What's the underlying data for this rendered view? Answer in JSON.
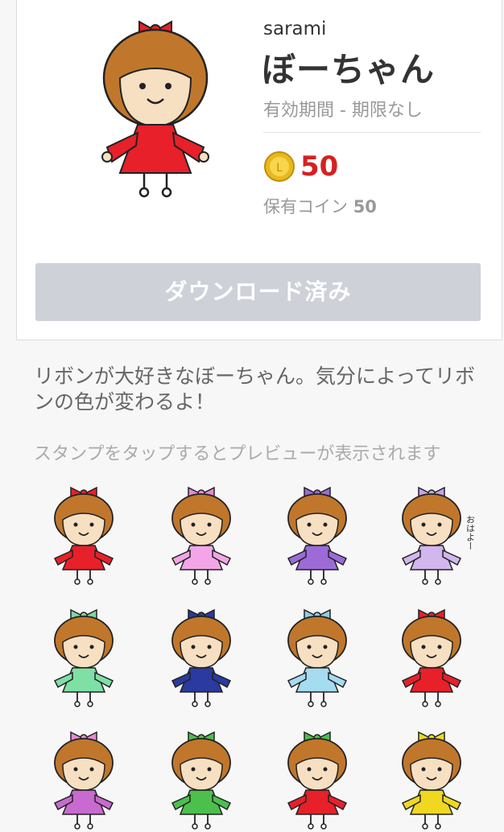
{
  "product": {
    "author": "sarami",
    "title": "ぼーちゃん",
    "validity": "有効期間 - 期限なし",
    "price": "50",
    "owned_label": "保有コイン",
    "owned_value": "50",
    "download_label": "ダウンロード済み",
    "coin_icon": "coin-icon"
  },
  "description": "リボンが大好きなぼーちゃん。気分によってリボンの色が変わるよ！",
  "preview_hint": "スタンプをタップするとプレビューが表示されます",
  "stickers": [
    {
      "ribbon": "#e8202a",
      "dress": "#e8202a",
      "text": ""
    },
    {
      "ribbon": "#e48ad6",
      "dress": "#f2a6e8",
      "text": ""
    },
    {
      "ribbon": "#9c6bd8",
      "dress": "#9c6bd8",
      "text": ""
    },
    {
      "ribbon": "#c8a2e8",
      "dress": "#d2b6ee",
      "text": "おはよー"
    },
    {
      "ribbon": "#7fd6a0",
      "dress": "#7fe0a6",
      "text": ""
    },
    {
      "ribbon": "#2a3aa0",
      "dress": "#2a3aa0",
      "text": ""
    },
    {
      "ribbon": "#8ccfe8",
      "dress": "#a6dcf0",
      "text": ""
    },
    {
      "ribbon": "#e8202a",
      "dress": "#e8202a",
      "text": ""
    },
    {
      "ribbon": "#e48ad6",
      "dress": "#c86ad0",
      "text": ""
    },
    {
      "ribbon": "#4cc04c",
      "dress": "#4cc04c",
      "text": ""
    },
    {
      "ribbon": "#4cc04c",
      "dress": "#e8202a",
      "text": ""
    },
    {
      "ribbon": "#f0d820",
      "dress": "#f0d820",
      "text": ""
    }
  ]
}
